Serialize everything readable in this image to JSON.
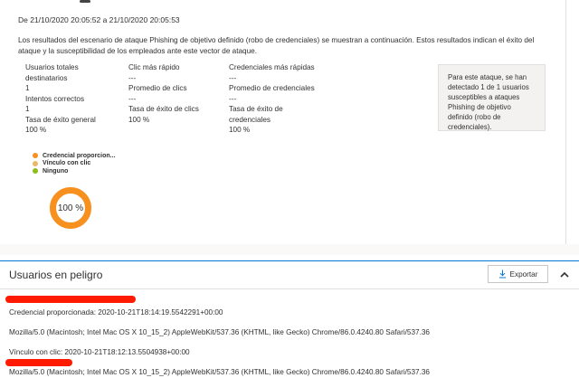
{
  "summary": {
    "date_range": "De 21/10/2020 20:05:52 a 21/10/2020 20:05:53",
    "intro": "Los resultados del escenario de ataque Phishing de objetivo definido (robo de credenciales) se muestran a continuación. Estos resultados indican el éxito del ataque y la susceptibilidad de los empleados ante este vector de ataque.",
    "col1": {
      "total_users_label": "Usuarios totales destinatarios",
      "total_users_value": "1",
      "attempts_label": "Intentos correctos",
      "attempts_value": "1",
      "rate_label": "Tasa de éxito general",
      "rate_value": "100 %"
    },
    "col2": {
      "fastest_click_label": "Clic más rápido",
      "fastest_click_value": "---",
      "avg_clicks_label": "Promedio de clics",
      "avg_clicks_value": "---",
      "click_rate_label": "Tasa de éxito de clics",
      "click_rate_value": "100 %"
    },
    "col3": {
      "fastest_creds_label": "Credenciales más rápidas",
      "fastest_creds_value": "---",
      "avg_creds_label": "Promedio de credenciales",
      "avg_creds_value": "---",
      "creds_rate_label": "Tasa de éxito de credenciales",
      "creds_rate_value": "100 %"
    },
    "info_box": "Para este ataque, se han detectado 1 de 1 usuarios susceptibles a ataques Phishing de objetivo definido (robo de credenciales)."
  },
  "legend": [
    {
      "label": "Credencial proporcion...",
      "color": "#f7901e"
    },
    {
      "label": "Vínculo con clic",
      "color": "#e8b96a"
    },
    {
      "label": "Ninguno",
      "color": "#8cbd18"
    }
  ],
  "donut": {
    "label": "100 %",
    "fraction": 1.0,
    "color": "#f7901e"
  },
  "at_risk": {
    "title": "Usuarios en peligro",
    "export_label": "Exportar",
    "entries": [
      {
        "event": "Credencial proporcionada: 2020-10-21T18:14:19.5542291+00:00"
      },
      {
        "agent": "Mozilla/5.0 (Macintosh; Intel Mac OS X 10_15_2) AppleWebKit/537.36 (KHTML, like Gecko) Chrome/86.0.4240.80 Safari/537.36"
      },
      {
        "event": "Vínculo con clic: 2020-10-21T18:12:13.5504938+00:00"
      },
      {
        "agent": "Mozilla/5.0 (Macintosh; Intel Mac OS X 10_15_2) AppleWebKit/537.36 (KHTML, like Gecko) Chrome/86.0.4240.80 Safari/537.36"
      }
    ]
  }
}
